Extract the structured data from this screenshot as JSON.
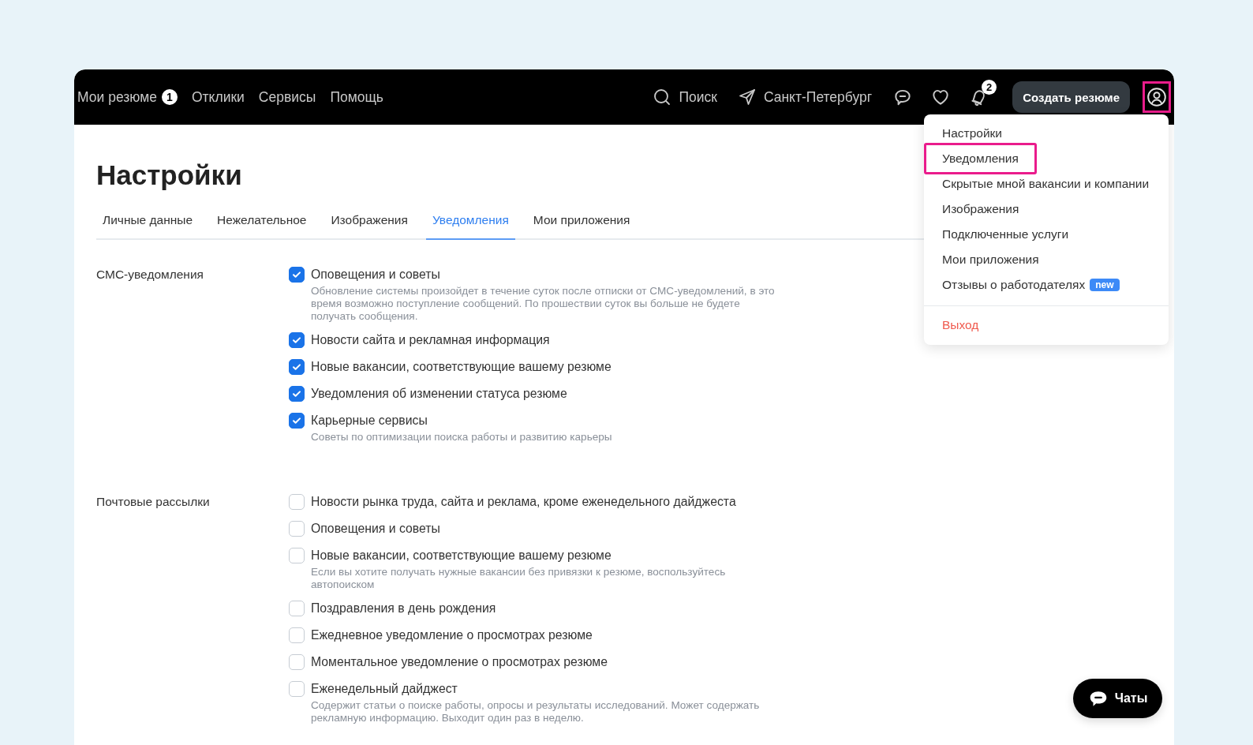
{
  "nav": {
    "links": [
      {
        "label": "Мои резюме",
        "badge": "1"
      },
      {
        "label": "Отклики"
      },
      {
        "label": "Сервисы"
      },
      {
        "label": "Помощь"
      }
    ],
    "search": "Поиск",
    "city": "Санкт-Петербург",
    "notifications_badge": "2",
    "create_button": "Создать резюме",
    "profile_highlighted": true
  },
  "title": "Настройки",
  "tabs": [
    {
      "label": "Личные данные",
      "selected": false
    },
    {
      "label": "Нежелательное",
      "selected": false
    },
    {
      "label": "Изображения",
      "selected": false
    },
    {
      "label": "Уведомления",
      "selected": true
    },
    {
      "label": "Мои приложения",
      "selected": false
    }
  ],
  "sections": [
    {
      "label": "СМС-уведомления",
      "options": [
        {
          "label": "Оповещения и советы",
          "checked": true,
          "hint": "Обновление системы произойдет в течение суток после отписки от СМС-уведомлений, в это время возможно поступление сообщений. По прошествии суток вы больше не будете получать сообщения."
        },
        {
          "label": "Новости сайта и рекламная информация",
          "checked": true
        },
        {
          "label": "Новые вакансии, соответствующие вашему резюме",
          "checked": true
        },
        {
          "label": "Уведомления об изменении статуса резюме",
          "checked": true
        },
        {
          "label": "Карьерные сервисы",
          "checked": true,
          "hint": "Советы по оптимизации поиска работы и развитию карьеры"
        }
      ]
    },
    {
      "label": "Почтовые рассылки",
      "options": [
        {
          "label": "Новости рынка труда, сайта и реклама, кроме еженедельного дайджеста",
          "checked": false
        },
        {
          "label": "Оповещения и советы",
          "checked": false
        },
        {
          "label": "Новые вакансии, соответствующие вашему резюме",
          "checked": false,
          "hint": "Если вы хотите получать нужные вакансии без привязки к резюме, воспользуйтесь автопоиском"
        },
        {
          "label": "Поздравления в день рождения",
          "checked": false
        },
        {
          "label": "Ежедневное уведомление о просмотрах резюме",
          "checked": false
        },
        {
          "label": "Моментальное уведомление о просмотрах резюме",
          "checked": false
        },
        {
          "label": "Еженедельный дайджест",
          "checked": false,
          "hint": "Содержит статьи о поиске работы, опросы и результаты исследований. Может содержать рекламную информацию. Выходит один раз в неделю."
        }
      ]
    }
  ],
  "menu": {
    "items": [
      {
        "kind": "item",
        "label": "Настройки",
        "highlighted": false
      },
      {
        "kind": "item",
        "label": "Уведомления",
        "highlighted": true
      },
      {
        "kind": "item",
        "label": "Скрытые мной вакансии и компании",
        "highlighted": false
      },
      {
        "kind": "item",
        "label": "Изображения",
        "highlighted": false
      },
      {
        "kind": "item",
        "label": "Подключенные услуги",
        "highlighted": false
      },
      {
        "kind": "item",
        "label": "Мои приложения",
        "highlighted": false
      },
      {
        "kind": "item",
        "label": "Отзывы о работодателях",
        "highlighted": false,
        "badge": "new"
      },
      {
        "kind": "logout",
        "label": "Выход",
        "highlighted": false
      }
    ]
  },
  "chat_button": "Чаты"
}
